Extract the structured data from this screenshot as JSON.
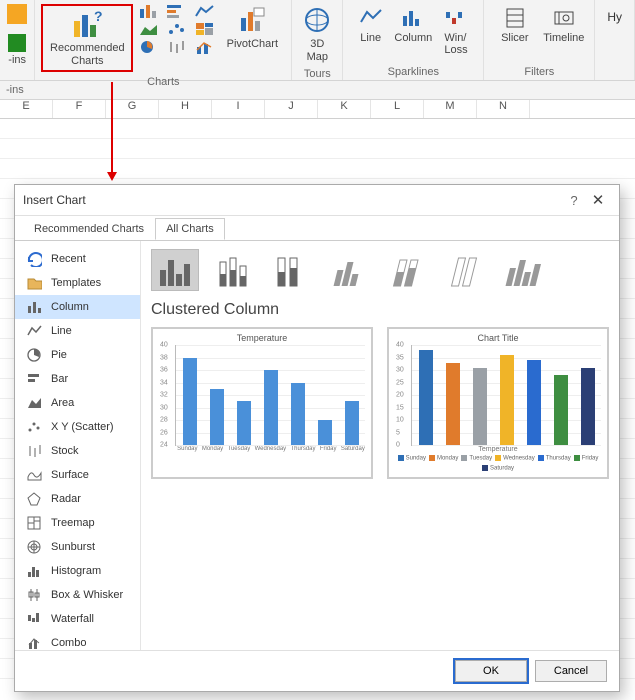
{
  "ribbon": {
    "addins_group": "-ins",
    "recommended": "Recommended\nCharts",
    "pivotchart": "PivotChart",
    "charts_group": "Charts",
    "map3d": "3D\nMap",
    "tours_group": "Tours",
    "sparklines": [
      "Line",
      "Column",
      "Win/\nLoss"
    ],
    "sparklines_group": "Sparklines",
    "filters": [
      "Slicer",
      "Timeline"
    ],
    "filters_group": "Filters",
    "hyper": "Hy"
  },
  "columns": [
    "E",
    "F",
    "G",
    "H",
    "I",
    "J",
    "K",
    "L",
    "M",
    "N"
  ],
  "dialog": {
    "title": "Insert Chart",
    "tabs": [
      "Recommended Charts",
      "All Charts"
    ],
    "active_tab": 1,
    "categories": [
      "Recent",
      "Templates",
      "Column",
      "Line",
      "Pie",
      "Bar",
      "Area",
      "X Y (Scatter)",
      "Stock",
      "Surface",
      "Radar",
      "Treemap",
      "Sunburst",
      "Histogram",
      "Box & Whisker",
      "Waterfall",
      "Combo"
    ],
    "selected_category": 2,
    "subtype_count": 7,
    "selected_subtype": 0,
    "chart_name": "Clustered Column",
    "preview1_title": "Temperature",
    "preview2_title": "Chart Title",
    "preview2_xaxis": "Temperature",
    "ok": "OK",
    "cancel": "Cancel"
  },
  "chart_data": [
    {
      "type": "bar",
      "title": "Temperature",
      "categories": [
        "Sunday",
        "Monday",
        "Tuesday",
        "Wednesday",
        "Thursday",
        "Friday",
        "Saturday"
      ],
      "values": [
        38,
        33,
        31,
        36,
        34,
        28,
        31
      ],
      "ylim": [
        24,
        40
      ],
      "ytick": 2,
      "color": "#4a90d9"
    },
    {
      "type": "bar",
      "title": "Chart Title",
      "categories": [
        "Sunday",
        "Monday",
        "Tuesday",
        "Wednesday",
        "Thursday",
        "Friday",
        "Saturday"
      ],
      "values": [
        38,
        33,
        31,
        36,
        34,
        28,
        31
      ],
      "ylim": [
        0,
        40
      ],
      "ytick": 5,
      "colors": [
        "#2e6fb5",
        "#e07b2c",
        "#9aa0a6",
        "#f0b428",
        "#2a6bcf",
        "#3e8e41",
        "#2b3f75"
      ],
      "xlabel": "Temperature",
      "legend": [
        "Sunday",
        "Monday",
        "Tuesday",
        "Wednesday",
        "Thursday",
        "Friday",
        "Saturday"
      ]
    }
  ]
}
